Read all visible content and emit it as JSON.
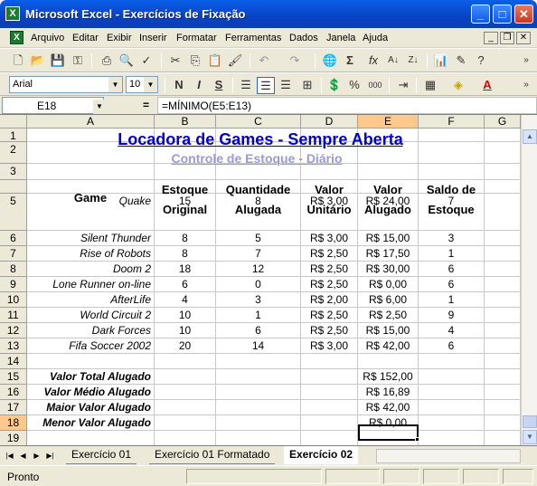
{
  "window": {
    "title": "Microsoft Excel - Exercícios de Fixação"
  },
  "menu": [
    "Arquivo",
    "Editar",
    "Exibir",
    "Inserir",
    "Formatar",
    "Ferramentas",
    "Dados",
    "Janela",
    "Ajuda"
  ],
  "toolbar": {
    "font_name": "Arial",
    "font_size": "10"
  },
  "formula_bar": {
    "cell_ref": "E18",
    "eq": "=",
    "formula": "=MÍNIMO(E5:E13)"
  },
  "columns": [
    "A",
    "B",
    "C",
    "D",
    "E",
    "F",
    "G"
  ],
  "rows": [
    "1",
    "2",
    "3",
    "4",
    "5",
    "6",
    "7",
    "8",
    "9",
    "10",
    "11",
    "12",
    "13",
    "14",
    "15",
    "16",
    "17",
    "18",
    "19"
  ],
  "sheet": {
    "title": "Locadora de Games - Sempre Aberta",
    "subtitle": "Controle de Estoque - Diário",
    "headers": {
      "game": "Game",
      "estoque_1": "Estoque",
      "estoque_2": "Original",
      "qtd_1": "Quantidade",
      "qtd_2": "Alugada",
      "valor_1": "Valor",
      "valor_2": "Unitário",
      "alugado_1": "Valor",
      "alugado_2": "Alugado",
      "saldo_1": "Saldo de",
      "saldo_2": "Estoque"
    },
    "games": [
      {
        "name": "Quake",
        "estoque": "15",
        "alugada": "8",
        "unitario": "R$ 3,00",
        "alugado": "R$ 24,00",
        "saldo": "7"
      },
      {
        "name": "Silent Thunder",
        "estoque": "8",
        "alugada": "5",
        "unitario": "R$ 3,00",
        "alugado": "R$ 15,00",
        "saldo": "3"
      },
      {
        "name": "Rise of Robots",
        "estoque": "8",
        "alugada": "7",
        "unitario": "R$ 2,50",
        "alugado": "R$ 17,50",
        "saldo": "1"
      },
      {
        "name": "Doom 2",
        "estoque": "18",
        "alugada": "12",
        "unitario": "R$ 2,50",
        "alugado": "R$ 30,00",
        "saldo": "6"
      },
      {
        "name": "Lone Runner on-line",
        "estoque": "6",
        "alugada": "0",
        "unitario": "R$ 2,50",
        "alugado": "R$ 0,00",
        "saldo": "6"
      },
      {
        "name": "AfterLife",
        "estoque": "4",
        "alugada": "3",
        "unitario": "R$ 2,00",
        "alugado": "R$ 6,00",
        "saldo": "1"
      },
      {
        "name": "World Circuit 2",
        "estoque": "10",
        "alugada": "1",
        "unitario": "R$ 2,50",
        "alugado": "R$ 2,50",
        "saldo": "9"
      },
      {
        "name": "Dark Forces",
        "estoque": "10",
        "alugada": "6",
        "unitario": "R$ 2,50",
        "alugado": "R$ 15,00",
        "saldo": "4"
      },
      {
        "name": "Fifa Soccer 2002",
        "estoque": "20",
        "alugada": "14",
        "unitario": "R$ 3,00",
        "alugado": "R$ 42,00",
        "saldo": "6"
      }
    ],
    "summary": [
      {
        "label": "Valor Total Alugado",
        "value": "R$ 152,00"
      },
      {
        "label": "Valor Médio Alugado",
        "value": "R$ 16,89"
      },
      {
        "label": "Maior Valor Alugado",
        "value": "R$ 42,00"
      },
      {
        "label": "Menor Valor Alugado",
        "value": "R$ 0,00"
      }
    ]
  },
  "tabs": [
    "Exercício 01",
    "Exercício 01 Formatado",
    "Exercício 02"
  ],
  "status": "Pronto",
  "colors": {
    "title": "#0000cc",
    "subtitle": "#9999dd",
    "active_header": "#ffc88c"
  }
}
